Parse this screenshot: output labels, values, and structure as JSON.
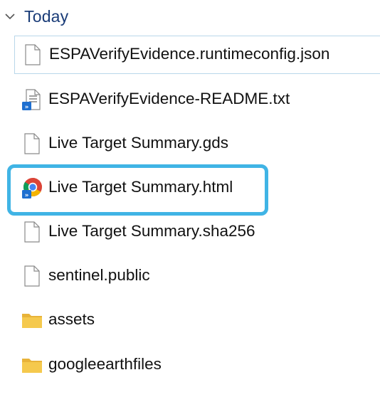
{
  "group": {
    "title": "Today"
  },
  "files": [
    {
      "name": "ESPAVerifyEvidence.runtimeconfig.json",
      "icon": "generic-file-icon"
    },
    {
      "name": "ESPAVerifyEvidence-README.txt",
      "icon": "text-file-shortcut-icon"
    },
    {
      "name": "Live Target Summary.gds",
      "icon": "generic-file-icon"
    },
    {
      "name": "Live Target Summary.html",
      "icon": "chrome-html-shortcut-icon"
    },
    {
      "name": "Live Target Summary.sha256",
      "icon": "generic-file-icon"
    },
    {
      "name": "sentinel.public",
      "icon": "generic-file-icon"
    },
    {
      "name": "assets",
      "icon": "folder-icon"
    },
    {
      "name": "googleearthfiles",
      "icon": "folder-icon"
    }
  ],
  "colors": {
    "group_title": "#1a3c78",
    "highlight_border": "#40b4e5",
    "hover_border": "#b9d7ea",
    "folder_yellow": "#f5c94d"
  }
}
